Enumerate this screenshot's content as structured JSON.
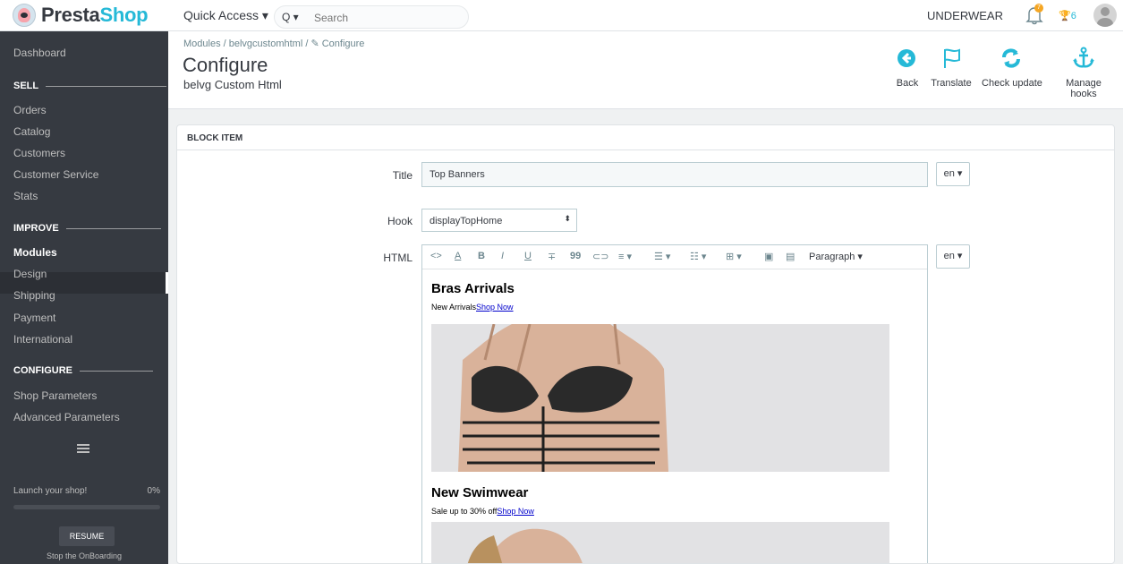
{
  "topbar": {
    "logo_prefix": "Presta",
    "logo_suffix": "Shop",
    "quick_access": "Quick Access ▾",
    "search_prefix": "Q ▾",
    "search_placeholder": "Search",
    "shop_name": "UNDERWEAR",
    "notifications_count": "7",
    "trophy_count": "6"
  },
  "sidebar": {
    "dashboard": "Dashboard",
    "sell_title": "SELL",
    "sell_items": [
      "Orders",
      "Catalog",
      "Customers",
      "Customer Service",
      "Stats"
    ],
    "improve_title": "IMPROVE",
    "improve_items": [
      "Modules",
      "Design",
      "Shipping",
      "Payment",
      "International"
    ],
    "configure_title": "CONFIGURE",
    "configure_items": [
      "Shop Parameters",
      "Advanced Parameters"
    ],
    "launch_label": "Launch your shop!",
    "launch_percent": "0%",
    "launch_progress": 0,
    "resume_label": "RESUME",
    "stop_label": "Stop the OnBoarding"
  },
  "header": {
    "breadcrumb": "Modules  /  belvgcustomhtml  /  ✎ Configure",
    "title": "Configure",
    "subtitle": "belvg Custom Html",
    "toolbar": [
      {
        "label": "Back",
        "icon": "back-icon"
      },
      {
        "label": "Translate",
        "icon": "flag-icon"
      },
      {
        "label": "Check update",
        "icon": "refresh-icon"
      },
      {
        "label": "Manage hooks",
        "icon": "anchor-icon"
      }
    ]
  },
  "form": {
    "panel_title": "BLOCK ITEM",
    "title_label": "Title",
    "title_value": "Top Banners",
    "title_lang": "en ▾",
    "hook_label": "Hook",
    "hook_value": "displayTopHome",
    "html_label": "HTML",
    "html_lang": "en ▾",
    "editor_toolbar": [
      "<>",
      "A",
      "B",
      "I",
      "U",
      "∓",
      "99",
      "⊂⊃",
      "≡ ▾",
      "☰ ▾",
      "☷ ▾",
      "⊞ ▾",
      "▣",
      "▤",
      "Paragraph ▾"
    ]
  },
  "editor_content": {
    "heading1": "Bras Arrivals",
    "text1": "New Arrivals",
    "link1": "Shop Now",
    "heading2": "New Swimwear",
    "text2": "Sale up to 30% off",
    "link2": "Shop Now"
  },
  "colors": {
    "brand": "#25b9d7",
    "sidebar_bg": "#363a41",
    "badge": "#f5a623"
  }
}
